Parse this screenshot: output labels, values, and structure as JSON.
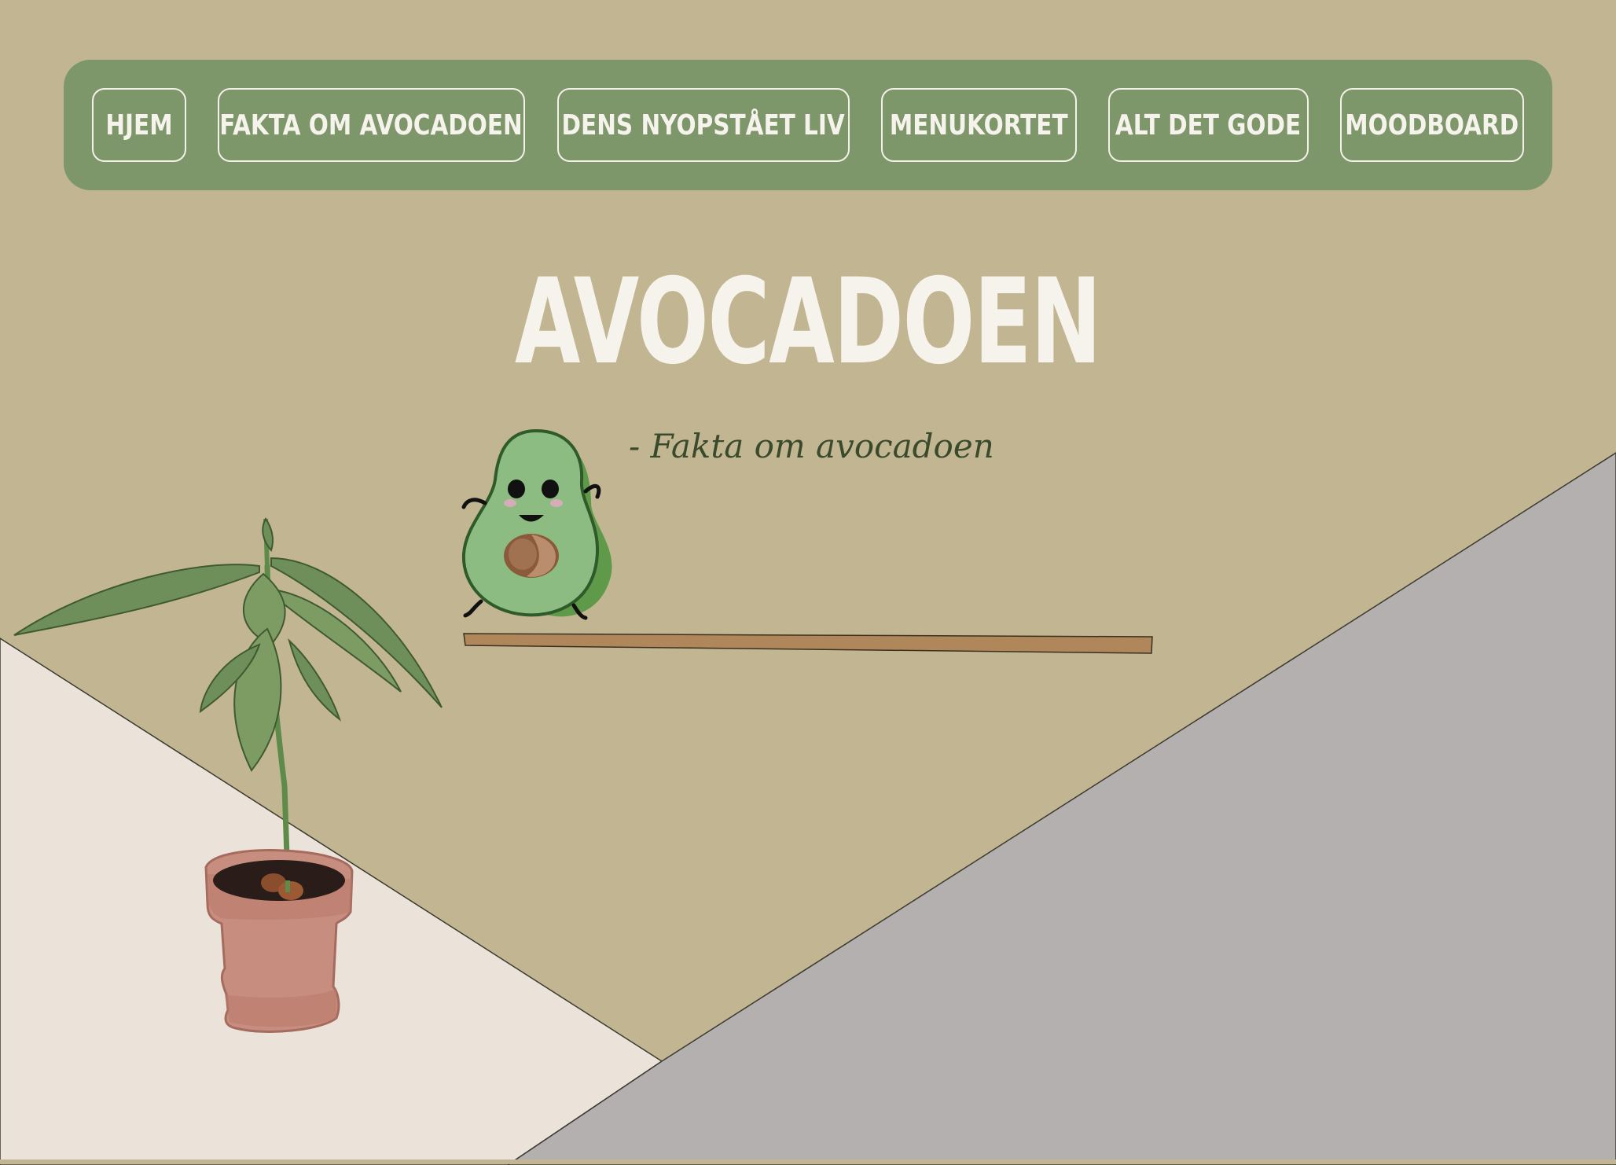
{
  "nav": {
    "items": [
      {
        "label": "HJEM"
      },
      {
        "label": "FAKTA OM AVOCADOEN"
      },
      {
        "label": "DENS NYOPSTÅET LIV"
      },
      {
        "label": "MENUKORTET"
      },
      {
        "label": "ALT DET GODE"
      },
      {
        "label": "MOODBOARD"
      }
    ]
  },
  "hero": {
    "title": "AVOCADOEN",
    "subtitle": "- Fakta om avocadoen"
  },
  "illustrations": {
    "mascot": "avocado-character",
    "plant": "avocado-plant-in-pot",
    "shelf": "wooden-shelf"
  },
  "colors": {
    "background": "#c2b692",
    "nav_background": "#7e976a",
    "nav_text": "#f6f3ec",
    "floor_light": "#ebe3d9",
    "floor_grey": "#b5b0b0",
    "shelf": "#b0875b",
    "title": "#f6f3ec",
    "subtitle": "#3a4a2c"
  }
}
